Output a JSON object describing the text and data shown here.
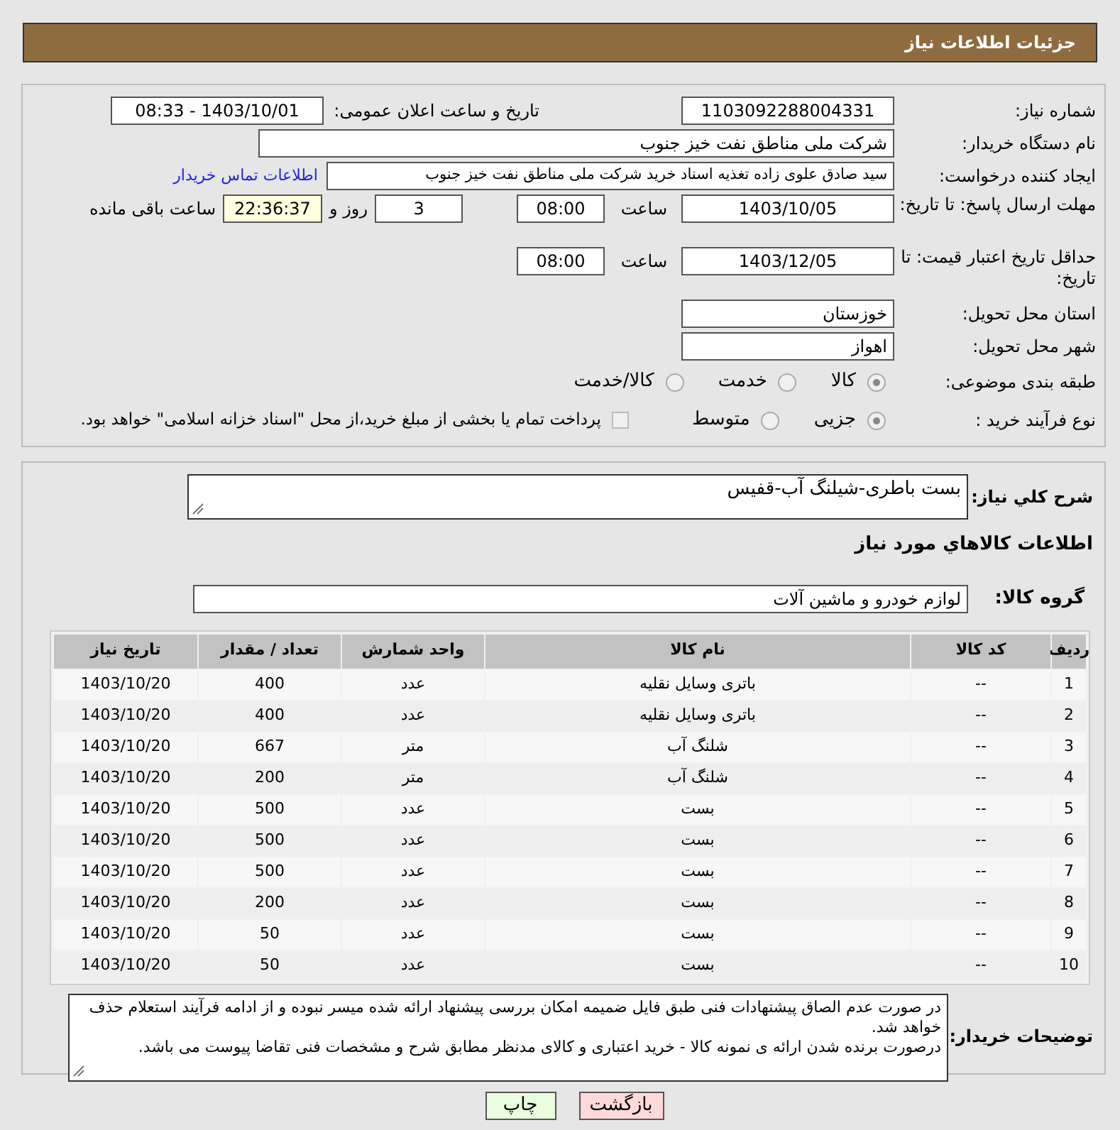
{
  "header": {
    "title": "جزئیات اطلاعات نیاز"
  },
  "need_number": {
    "label": "شماره نیاز:",
    "value": "1103092288004331"
  },
  "announce": {
    "label": "تاریخ و ساعت اعلان عمومی:",
    "value": "1403/10/01 - 08:33"
  },
  "buyer_org": {
    "label": "نام دستگاه خریدار:",
    "value": "شرکت ملی مناطق نفت خیز جنوب"
  },
  "requester": {
    "label": "ایجاد کننده درخواست:",
    "value": "سید صادق علوی زاده  تغذیه اسناد خرید  شرکت ملی مناطق نفت خیز جنوب",
    "link": "اطلاعات تماس خریدار"
  },
  "reply_deadline": {
    "label": "مهلت ارسال پاسخ: تا تاریخ:",
    "date": "1403/10/05",
    "time_label": "ساعت",
    "time": "08:00",
    "days": "3",
    "days_label": "روز و",
    "remaining": "22:36:37",
    "remaining_label": "ساعت باقی مانده"
  },
  "price_validity": {
    "label": "حداقل تاریخ اعتبار قیمت: تا تاریخ:",
    "date": "1403/12/05",
    "time_label": "ساعت",
    "time": "08:00"
  },
  "province": {
    "label": "استان محل تحویل:",
    "value": "خوزستان"
  },
  "city": {
    "label": "شهر محل تحویل:",
    "value": "اهواز"
  },
  "category": {
    "label": "طبقه بندی موضوعی:",
    "options": [
      {
        "label": "کالا",
        "selected": true
      },
      {
        "label": "خدمت",
        "selected": false
      },
      {
        "label": "کالا/خدمت",
        "selected": false
      }
    ]
  },
  "process": {
    "label": "نوع فرآیند خرید :",
    "options": [
      {
        "label": "جزیی",
        "selected": true
      },
      {
        "label": "متوسط",
        "selected": false
      }
    ],
    "payment": {
      "checked": false,
      "label": "پرداخت تمام یا بخشی از مبلغ خرید،از محل \"اسناد خزانه اسلامی\" خواهد بود."
    }
  },
  "description": {
    "label": "شرح کلي نياز:",
    "value": "بست باطری-شیلنگ آب-قفیس"
  },
  "goods_title": "اطلاعات کالاهاي مورد نياز",
  "goods_group": {
    "label": "گروه کالا:",
    "value": "لوازم خودرو و ماشین آلات"
  },
  "table": {
    "columns": [
      "ردیف",
      "کد کالا",
      "نام کالا",
      "واحد شمارش",
      "تعداد / مقدار",
      "تاریخ نیاز"
    ],
    "rows": [
      [
        "1",
        "--",
        "باتری وسایل نقلیه",
        "عدد",
        "400",
        "1403/10/20"
      ],
      [
        "2",
        "--",
        "باتری وسایل نقلیه",
        "عدد",
        "400",
        "1403/10/20"
      ],
      [
        "3",
        "--",
        "شلنگ آب",
        "متر",
        "667",
        "1403/10/20"
      ],
      [
        "4",
        "--",
        "شلنگ آب",
        "متر",
        "200",
        "1403/10/20"
      ],
      [
        "5",
        "--",
        "بست",
        "عدد",
        "500",
        "1403/10/20"
      ],
      [
        "6",
        "--",
        "بست",
        "عدد",
        "500",
        "1403/10/20"
      ],
      [
        "7",
        "--",
        "بست",
        "عدد",
        "500",
        "1403/10/20"
      ],
      [
        "8",
        "--",
        "بست",
        "عدد",
        "200",
        "1403/10/20"
      ],
      [
        "9",
        "--",
        "بست",
        "عدد",
        "50",
        "1403/10/20"
      ],
      [
        "10",
        "--",
        "بست",
        "عدد",
        "50",
        "1403/10/20"
      ]
    ]
  },
  "notes": {
    "label": "توضیحات خریدار:",
    "value": "در صورت عدم الصاق پیشنهادات فنی طبق فایل ضمیمه امکان بررسی پیشنهاد ارائه شده میسر نبوده و از ادامه فرآیند استعلام حذف خواهد شد.\nدرصورت برنده شدن ارائه ی نمونه کالا - خرید اعتباری و کالای مدنظر مطابق شرح و مشخصات فنی تقاضا پیوست می باشد."
  },
  "buttons": [
    {
      "kind": "back",
      "label": "بازگشت"
    },
    {
      "kind": "print",
      "label": "چاپ"
    }
  ]
}
